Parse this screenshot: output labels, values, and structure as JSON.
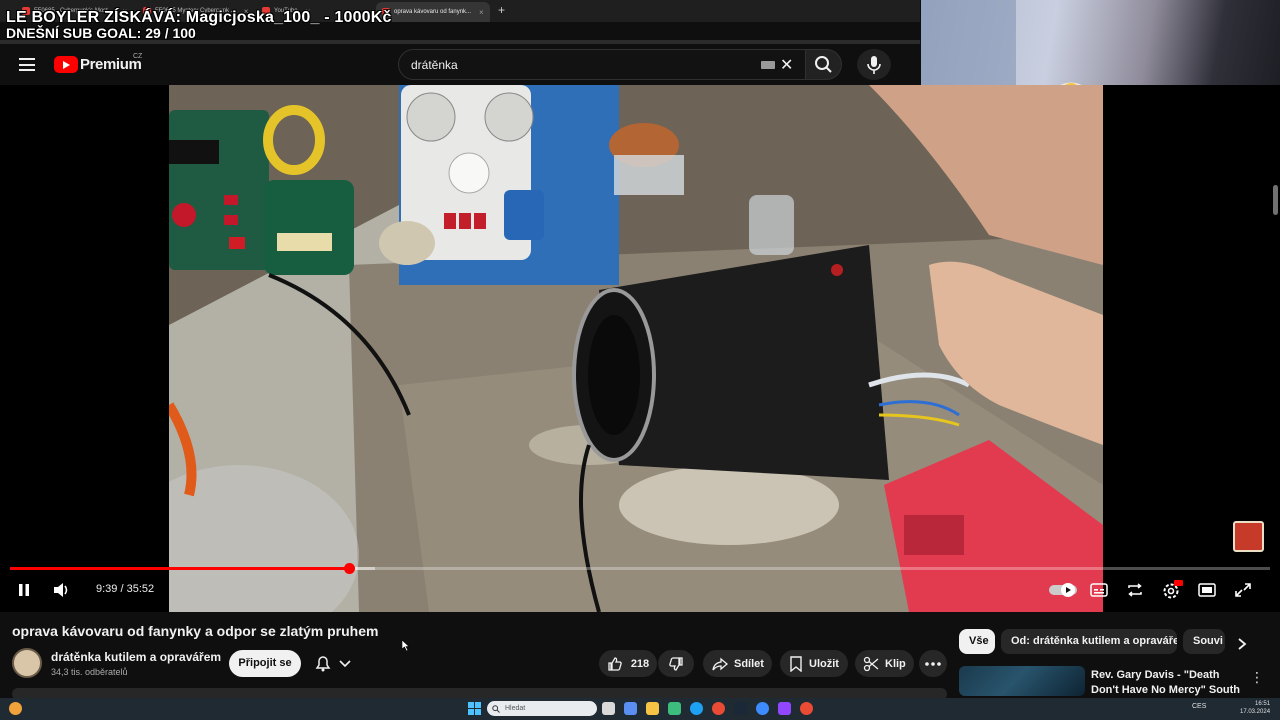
{
  "browser": {
    "tabs": [
      {
        "label": "FF0685 - Cyberpunk's Most ..."
      },
      {
        "label": "FF0685 Mystery Cyberpunk ..."
      },
      {
        "label": "YouTube"
      },
      {
        "label": "oprava kávovaru od fanynk..."
      }
    ],
    "new_tab": "+"
  },
  "stream_overlay": {
    "line1": "LE BOYLER ZÍSKÁVÁ: Magicjoska_100_ - 1000Kč",
    "line2": "DNEŠNÍ SUB GOAL:  29 / 100"
  },
  "header": {
    "brand": "Premium",
    "country": "CZ",
    "search_value": "drátěnka"
  },
  "player": {
    "time": "9:39 / 35:52",
    "progress": 0.2697,
    "buffered": 0.29
  },
  "video": {
    "title": "oprava kávovaru od fanynky a odpor se zlatým pruhem",
    "channel": "drátěnka kutilem a opravářem",
    "subscribers": "34,3 tis. odběratelů",
    "join_label": "Připojit se",
    "likes": "218",
    "share_label": "Sdílet",
    "save_label": "Uložit",
    "clip_label": "Klip"
  },
  "chips": [
    {
      "label": "Vše"
    },
    {
      "label": "Od: drátěnka kutilem a opravářem"
    },
    {
      "label": "Souvi"
    }
  ],
  "recommendation": {
    "title": "Rev. Gary Davis - \"Death Don't Have No Mercy\" South of ..."
  },
  "taskbar": {
    "search_placeholder": "Hledat",
    "language": "CES",
    "time": "16:51",
    "date": "17.03.2024"
  },
  "colors": {
    "accent": "#ff0000",
    "background": "#0f0f0f",
    "chip_bg": "#272727"
  }
}
